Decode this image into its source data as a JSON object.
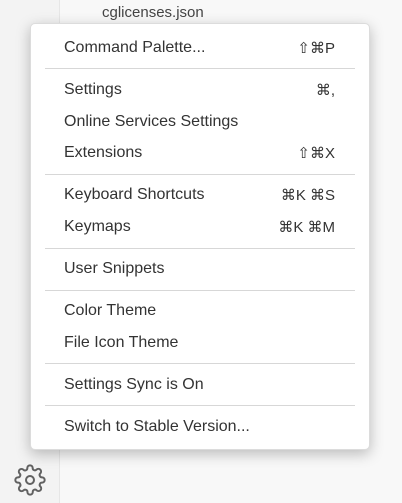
{
  "explorer": {
    "file_label": "cglicenses.json"
  },
  "menu": {
    "command_palette": {
      "label": "Command Palette...",
      "shortcut": "⇧⌘P"
    },
    "settings": {
      "label": "Settings",
      "shortcut": "⌘,"
    },
    "online_services_settings": {
      "label": "Online Services Settings",
      "shortcut": ""
    },
    "extensions": {
      "label": "Extensions",
      "shortcut": "⇧⌘X"
    },
    "keyboard_shortcuts": {
      "label": "Keyboard Shortcuts",
      "shortcut": "⌘K ⌘S"
    },
    "keymaps": {
      "label": "Keymaps",
      "shortcut": "⌘K ⌘M"
    },
    "user_snippets": {
      "label": "User Snippets",
      "shortcut": ""
    },
    "color_theme": {
      "label": "Color Theme",
      "shortcut": ""
    },
    "file_icon_theme": {
      "label": "File Icon Theme",
      "shortcut": ""
    },
    "settings_sync": {
      "label": "Settings Sync is On",
      "shortcut": ""
    },
    "switch_stable": {
      "label": "Switch to Stable Version...",
      "shortcut": ""
    }
  },
  "activity_bar": {
    "manage_icon": "gear-icon"
  }
}
